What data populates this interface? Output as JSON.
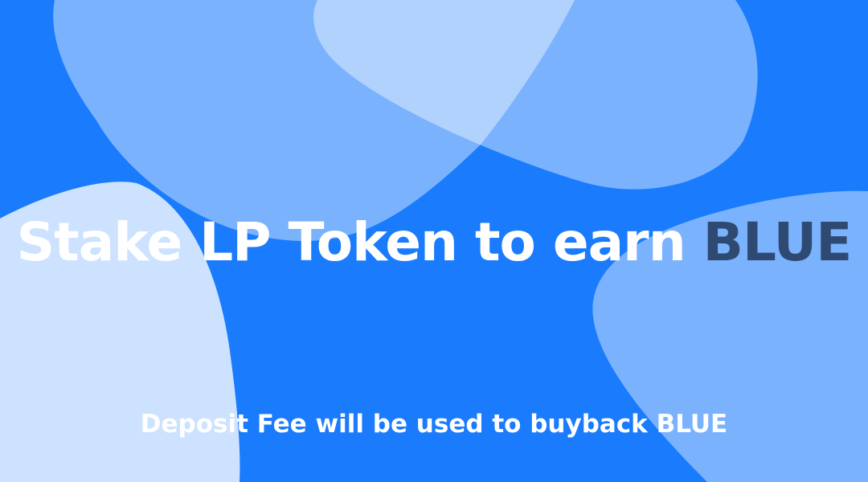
{
  "headline": {
    "text": "Stake LP Token to earn",
    "accent": "BLUE"
  },
  "subline": {
    "text": "Deposit Fee will be used to buyback BLUE"
  },
  "colors": {
    "background": "#1a7bfd",
    "accent_text": "#2f4a72",
    "text": "#ffffff"
  }
}
